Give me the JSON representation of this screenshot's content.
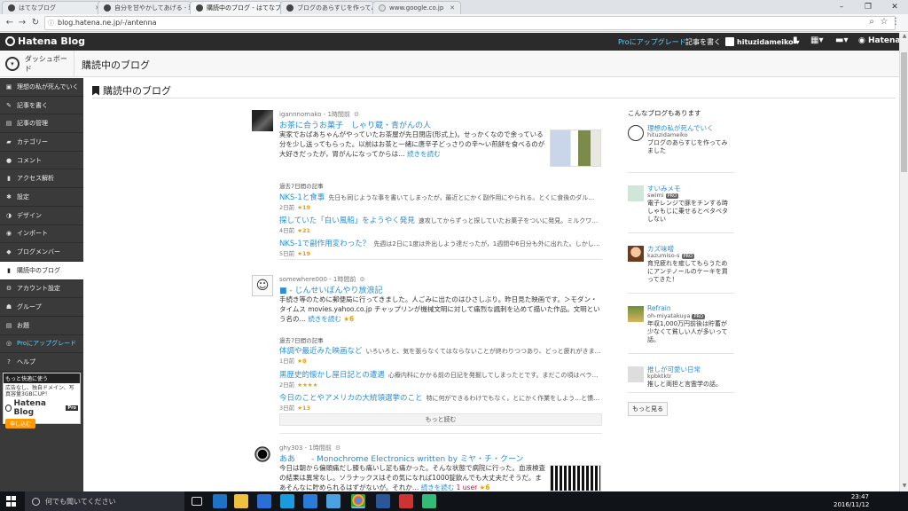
{
  "browser": {
    "tabs": [
      {
        "title": "はてなブログ",
        "active": false
      },
      {
        "title": "自分を甘やかしてあげる - 理...",
        "active": false
      },
      {
        "title": "購読中のブログ - はてなブロ...",
        "active": true
      },
      {
        "title": "ブログのあらすじを作ってみ...",
        "active": false
      },
      {
        "title": "www.google.co.jp",
        "active": false
      }
    ],
    "url": "blog.hatena.ne.jp/-/antenna",
    "window_controls": {
      "minimize": "–",
      "maximize": "❐",
      "close": "✕"
    }
  },
  "hatena_header": {
    "logo": "Hatena Blog",
    "upgrade_label": "Proにアップグレード",
    "write_label": "記事を書く",
    "user": "hituzidameiko",
    "brand": "Hatena"
  },
  "subheader": {
    "dashboard_label": "ダッシュボード",
    "page_heading": "購読中のブログ"
  },
  "sidebar": {
    "items": [
      {
        "label": "理想の私が死んでいく",
        "icon": "blog-icon"
      },
      {
        "label": "記事を書く",
        "icon": "pencil-icon"
      },
      {
        "label": "記事の管理",
        "icon": "document-icon"
      },
      {
        "label": "カテゴリー",
        "icon": "folder-icon"
      },
      {
        "label": "コメント",
        "icon": "comment-icon"
      },
      {
        "label": "アクセス解析",
        "icon": "chart-icon"
      },
      {
        "label": "設定",
        "icon": "wrench-icon"
      },
      {
        "label": "デザイン",
        "icon": "palette-icon"
      },
      {
        "label": "インポート",
        "icon": "import-icon"
      },
      {
        "label": "ブログメンバー",
        "icon": "members-icon"
      },
      {
        "label": "購読中のブログ",
        "icon": "bookmark-icon",
        "active": true
      },
      {
        "label": "アカウント設定",
        "icon": "gear-icon"
      },
      {
        "label": "グループ",
        "icon": "group-icon"
      },
      {
        "label": "お題",
        "icon": "theme-icon"
      },
      {
        "label": "Proにアップグレード",
        "icon": "pro-icon",
        "pro": true
      },
      {
        "label": "ヘルプ",
        "icon": "help-icon"
      }
    ],
    "promo": {
      "header": "もっと快適に使う",
      "text": "広告なし、独自ドメイン、写真容量3GBにUP！",
      "logo": "Hatena Blog",
      "badge": "Pro",
      "button": "申し込む"
    }
  },
  "main": {
    "title": "購読中のブログ",
    "entries": [
      {
        "meta": "igannnomako - 1時間前",
        "title": "お茶に合うお菓子　しゃり蔵・青がんの人",
        "body": "実家でおばあちゃんがやっていたお茶屋が先日閉店(形式上)。せっかくなので余っている分を少し送ってもらった。以前はお茶と一緒に唐辛子どっさりの辛〜い煎餅を食べるのが大好きだったが，胃がんになってからは…",
        "more": "続きを読む",
        "past_label": "過去7日間の記事",
        "past": [
          {
            "title": "NKS-1と食事",
            "desc": "先日も同じような事を書いてしまったが，最近とにかく副作用にやられる。とくに食後のダル…",
            "sub": "2日前",
            "stars": "★19"
          },
          {
            "title": "探していた「白い風船」をようやく発見",
            "desc": "速攻してからずっと探していたお菓子をついに発見。ミルクワ…",
            "sub": "4日前",
            "stars": "★21"
          },
          {
            "title": "NKS-1で副作用変わった？",
            "desc": "先週は2日に1度は外出しよう達だったが，1週間中6日分も外に出れた。しかし…",
            "sub": "5日前",
            "stars": "★19"
          }
        ]
      },
      {
        "meta": "somewhere000 - 1時間前",
        "title": "■ - じんせいぽんやり放浪記",
        "body": "手続き等のために郵便局に行ってきました。人ごみに出たのはひさしぶり。昨日見た映画です。＞モダン・タイムス movies.yahoo.co.jp チャップリンが機械文明に対して痛烈な諷刺を込めて描いた作品。文明という名の…",
        "more": "続きを読む",
        "stars": "★6",
        "past_label": "過去7日間の記事",
        "past": [
          {
            "title": "体調や最近みた映画など",
            "desc": "いろいろと、気を張らなくてはならないことが終わりつつあり、どっと疲れがきま…",
            "sub": "1日前",
            "stars": "★8"
          },
          {
            "title": "黒歴史的懐かし屋日記との遭遇",
            "desc": "心療内科にかかる前の日記を発掘してしまったとです。まだこの頃はベラ…",
            "sub": "2日前",
            "stars": "★★★★"
          },
          {
            "title": "今日のことやアメリカの大統領選挙のこと",
            "desc": "特に何ができるわけでもなく，とにかく作業をしよう…と慣…",
            "sub": "3日前",
            "stars": "★13"
          }
        ],
        "more_button": "もっと読む"
      },
      {
        "meta": "ghy303 - 1時間前",
        "title": "ああ　　- Monochrome Electronics written by ミヤ・チ・クーン",
        "body": "今日は朝から偏頭痛だし膝も痛いし足も痛かった。そんな状態で病院に行った。血液検査の結果は異常なし。ソラナックスはその気になれば1000錠飲んでも大丈夫だそうだ。まあそんなに貯められるはずがないが。それか…",
        "more": "続きを読む",
        "badge": "1 user",
        "stars": "★6"
      }
    ]
  },
  "right_column": {
    "heading": "こんなブログもあります",
    "blogs": [
      {
        "name": "理想の私が死んでいく",
        "user": "hituzidameiko",
        "pro": false,
        "desc": "ブログのあらすじを作ってみました"
      },
      {
        "name": "すいみメモ",
        "user": "swimi",
        "pro": true,
        "desc": "電子レンジで豚をチンする時しゃもじに乗せるとベタベタしない"
      },
      {
        "name": "カズ味噌",
        "user": "kazumiso-s",
        "pro": true,
        "desc": "育児疲れを癒してもらうためにアンテノールのケーキを買ってきた！"
      },
      {
        "name": "Refrain",
        "user": "oh-miyatakuya",
        "pro": true,
        "desc": "年収1,000万円前後は貯蓄が少なくて貧しい人が多いって話。"
      },
      {
        "name": "推しが可愛い日常",
        "user": "kpbktktr",
        "pro": false,
        "desc": "推しと両担と言霊学の話。"
      }
    ],
    "more_button": "もっと見る"
  },
  "taskbar": {
    "search_placeholder": "何でも聞いてください",
    "time": "23:47",
    "date": "2016/11/12"
  }
}
